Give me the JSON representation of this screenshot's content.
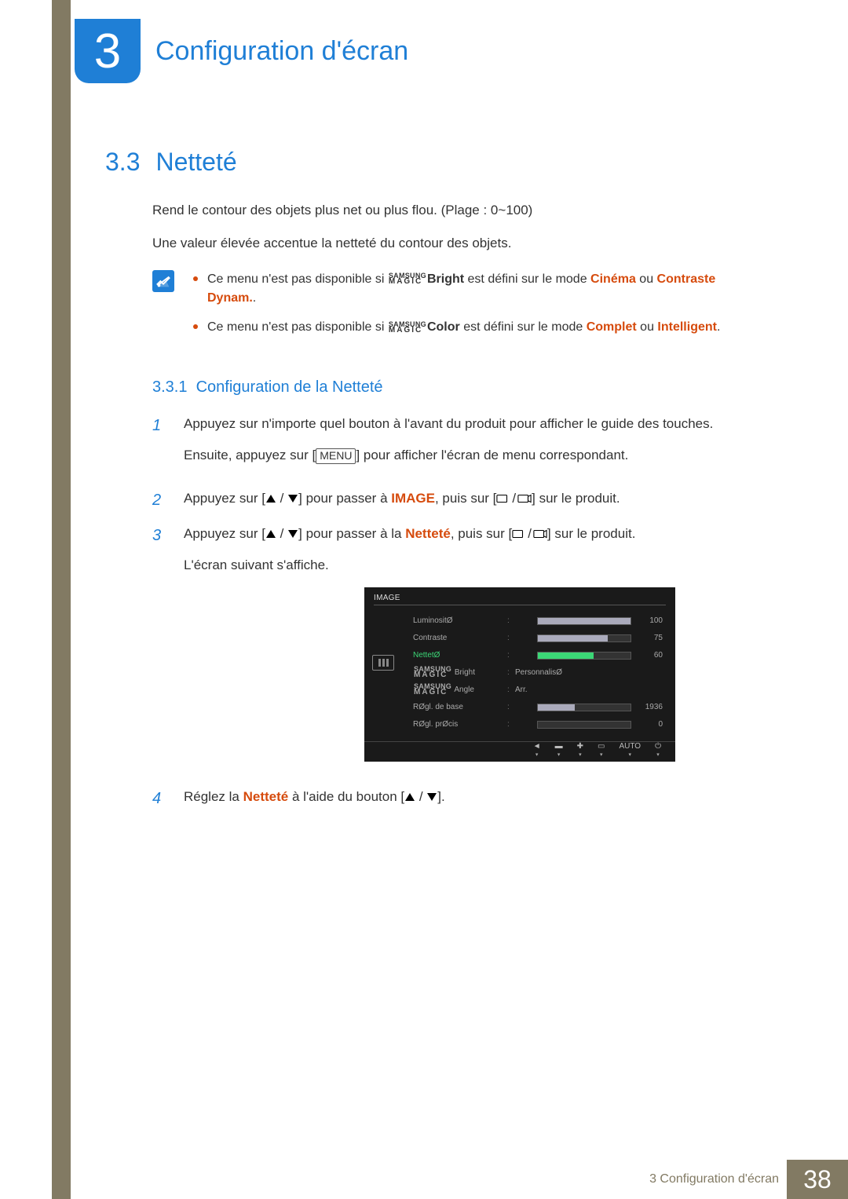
{
  "chapter": {
    "number": "3",
    "title": "Configuration d'écran"
  },
  "section": {
    "number": "3.3",
    "title": "Netteté"
  },
  "intro": {
    "p1": "Rend le contour des objets plus net ou plus flou. (Plage : 0~100)",
    "p2": "Une valeur élevée accentue la netteté du contour des objets."
  },
  "notes": {
    "n1": {
      "pre": "Ce menu n'est pas disponible si ",
      "feature": "Bright",
      "mid": " est défini sur le mode ",
      "opt1": "Cinéma",
      "or": " ou ",
      "opt2": "Contraste Dynam.",
      "post": "."
    },
    "n2": {
      "pre": "Ce menu n'est pas disponible si ",
      "feature": "Color",
      "mid": " est défini sur le mode ",
      "opt1": "Complet",
      "or": " ou ",
      "opt2": "Intelligent",
      "post": "."
    }
  },
  "subsection": {
    "number": "3.3.1",
    "title": "Configuration de la Netteté"
  },
  "steps": {
    "s1": {
      "p1": "Appuyez sur n'importe quel bouton à l'avant du produit pour afficher le guide des touches.",
      "p2a": "Ensuite, appuyez sur [",
      "menu": "MENU",
      "p2b": "] pour afficher l'écran de menu correspondant."
    },
    "s2": {
      "pre": "Appuyez sur [",
      "mid": "] pour passer à ",
      "target": "IMAGE",
      "post1": ", puis sur [",
      "post2": "] sur le produit."
    },
    "s3": {
      "pre": "Appuyez sur [",
      "mid": "] pour passer à la ",
      "target": "Netteté",
      "post1": ", puis sur [",
      "post2": "] sur le produit.",
      "p2": "L'écran suivant s'affiche."
    },
    "s4": {
      "pre": "Réglez la ",
      "target": "Netteté",
      "mid": " à l'aide du bouton [",
      "post": "]."
    }
  },
  "osd": {
    "tab": "IMAGE",
    "rows": [
      {
        "label": "LuminositØ",
        "value": "100",
        "fill": 100
      },
      {
        "label": "Contraste",
        "value": "75",
        "fill": 75
      },
      {
        "label": "NettetØ",
        "value": "60",
        "fill": 60,
        "selected": true
      },
      {
        "label": "Bright",
        "text": "PersonnalisØ",
        "magic": true
      },
      {
        "label": "Angle",
        "text": "Arr.",
        "magic": true
      },
      {
        "label": "RØgl. de base",
        "value": "1936",
        "fill": 40
      },
      {
        "label": "RØgl. prØcis",
        "value": "0",
        "fill": 0
      }
    ],
    "bottom": [
      "◄",
      "▬",
      "✚",
      "▭",
      "AUTO",
      "⏻"
    ]
  },
  "magic": {
    "top": "SAMSUNG",
    "bot": "MAGIC"
  },
  "footer": {
    "text": "3 Configuration d'écran",
    "page": "38"
  }
}
